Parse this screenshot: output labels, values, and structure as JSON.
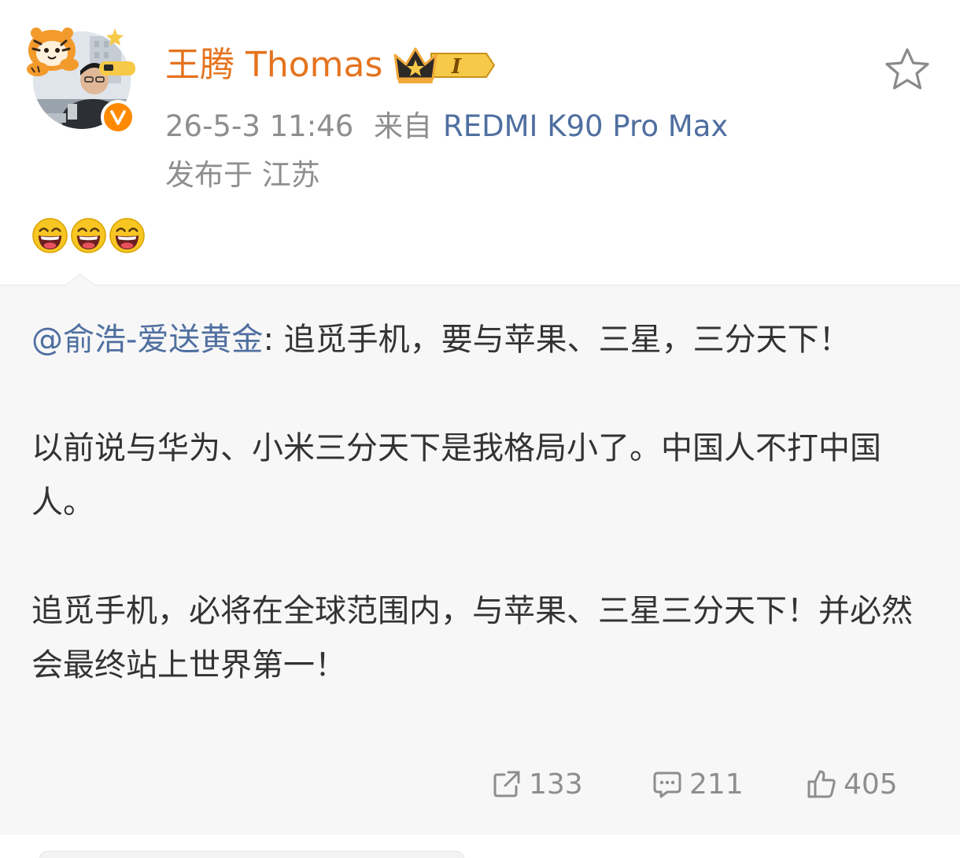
{
  "post": {
    "author_name": "王腾 Thomas",
    "vip_level": "I",
    "time": "26-5-3 11:46",
    "source_prefix": "来自",
    "device": "REDMI K90 Pro Max",
    "location": "发布于 江苏",
    "emoji_count": 3
  },
  "repost": {
    "mention": "@俞浩-爱送黄金",
    "text": ": 追觅手机，要与苹果、三星，三分天下！\n\n以前说与华为、小米三分天下是我格局小了。中国人不打中国人。\n\n追觅手机，必将在全球范围内，与苹果、三星三分天下！并必然会最终站上世界第一！"
  },
  "actions": {
    "reposts": "133",
    "comments": "211",
    "likes": "405"
  },
  "icons": {
    "avatar_decoration": "tiger-icon",
    "verified": "verified-v-icon",
    "vip": "crown-icon",
    "follow": "star-icon",
    "emoji": "laughing-emoji-icon",
    "repost": "share-icon",
    "comment": "comment-icon",
    "like": "thumbs-up-icon"
  },
  "colors": {
    "author_name": "#e5731e",
    "link": "#4f6fa0",
    "meta": "#8e8e8e",
    "verified_badge": "#ff8a00",
    "repost_background": "#f7f7f7"
  }
}
